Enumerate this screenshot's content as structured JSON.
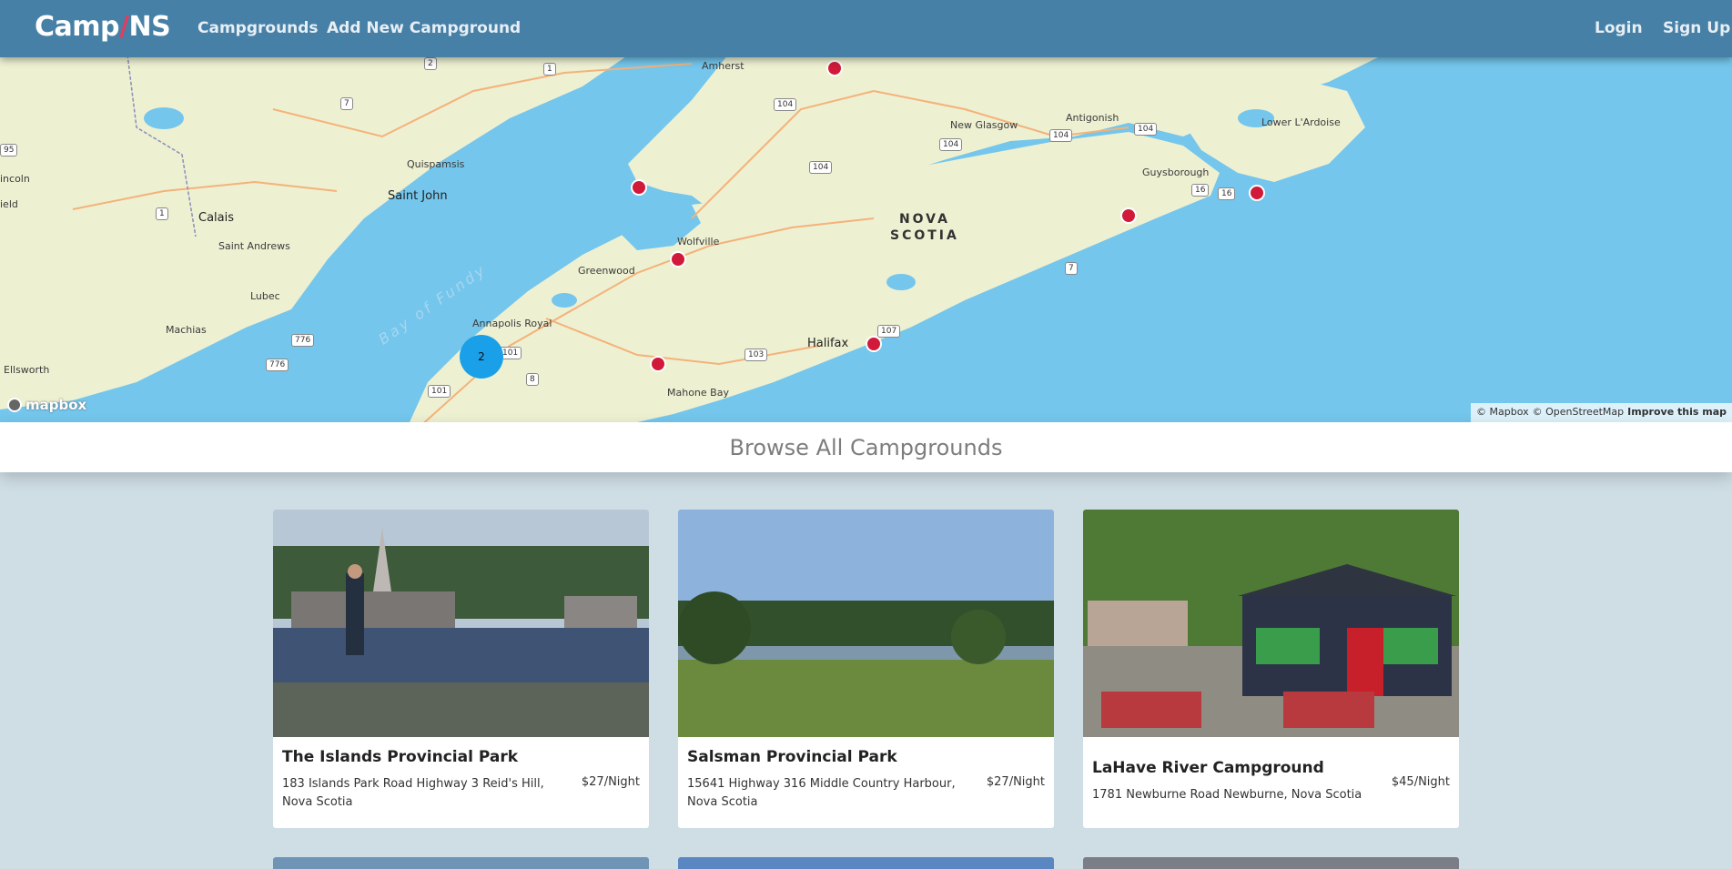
{
  "navbar": {
    "brand_part1": "Camp",
    "brand_slash": "/",
    "brand_part2": "NS",
    "links": [
      "Campgrounds",
      "Add New Campground"
    ],
    "login": "Login",
    "signup": "Sign Up"
  },
  "map": {
    "cluster_count": "2",
    "labels": {
      "amherst": "Amherst",
      "new_glasgow": "New Glasgow",
      "antigonish": "Antigonish",
      "lower_lardoise": "Lower L'Ardoise",
      "guysborough": "Guysborough",
      "quispamsis": "Quispamsis",
      "saint_john": "Saint John",
      "calais": "Calais",
      "saint_andrews": "Saint Andrews",
      "lincoln": "incoln",
      "field": "ield",
      "lubec": "Lubec",
      "machias": "Machias",
      "ellsworth": "Ellsworth",
      "wolfville": "Wolfville",
      "greenwood": "Greenwood",
      "annapolis_royal": "Annapolis Royal",
      "halifax": "Halifax",
      "mahone_bay": "Mahone Bay",
      "nova": "NOVA",
      "scotia": "SCOTIA",
      "bay_of_fundy": "Bay of Fundy"
    },
    "shields": [
      "2",
      "1",
      "7",
      "104",
      "104",
      "104",
      "104",
      "104",
      "16",
      "16",
      "1",
      "7",
      "776",
      "776",
      "101",
      "101",
      "8",
      "103",
      "107",
      "95"
    ],
    "logo": "mapbox",
    "attribution_mapbox": "© Mapbox",
    "attribution_osm": "© OpenStreetMap",
    "attribution_improve": "Improve this map"
  },
  "browse_title": "Browse All Campgrounds",
  "campgrounds": [
    {
      "name": "The Islands Provincial Park",
      "address": "183 Islands Park Road Highway 3 Reid's Hill, Nova Scotia",
      "price": "$27/Night"
    },
    {
      "name": "Salsman Provincial Park",
      "address": "15641 Highway 316 Middle Country Harbour, Nova Scotia",
      "price": "$27/Night"
    },
    {
      "name": "LaHave River Campground",
      "address": "1781 Newburne Road Newburne, Nova Scotia",
      "price": "$45/Night"
    }
  ],
  "colors": {
    "navbar": "#4680a6",
    "page_bg": "#cfdde5",
    "marker": "#d11a3a",
    "cluster": "#1aa0e8",
    "water": "#74c6ec",
    "land": "#eef0d2"
  }
}
